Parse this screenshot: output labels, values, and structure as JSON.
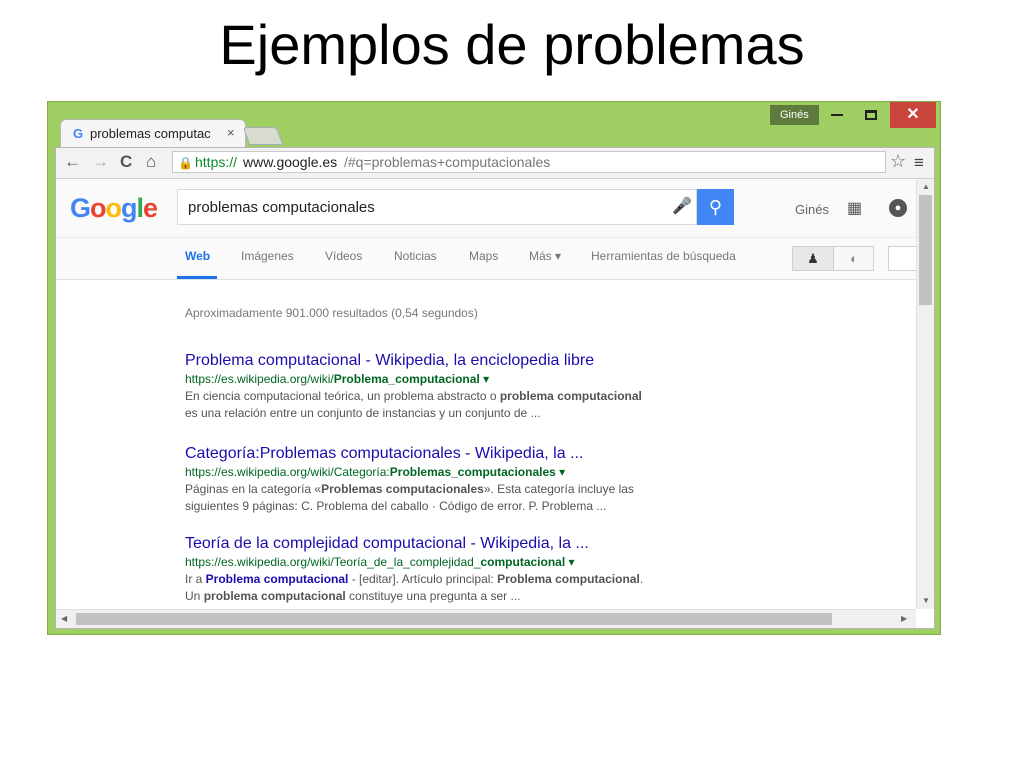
{
  "slide": {
    "title": "Ejemplos de problemas"
  },
  "window": {
    "user": "Ginés",
    "minimize_icon": "minimize-icon",
    "maximize_icon": "maximize-icon",
    "close_icon": "close-icon",
    "close_glyph": "✕"
  },
  "tab": {
    "favicon": "G",
    "title": "problemas computac",
    "close": "×"
  },
  "toolbar": {
    "back": "←",
    "forward": "→",
    "reload": "C",
    "home": "⌂",
    "url_scheme": "https://",
    "url_host": "www.google.es",
    "url_rest": "/#q=problemas+computacionales",
    "star": "☆",
    "menu": "≡"
  },
  "google": {
    "logo": [
      {
        "ch": "G",
        "color": "#4285f4"
      },
      {
        "ch": "o",
        "color": "#ea4335"
      },
      {
        "ch": "o",
        "color": "#fbbc05"
      },
      {
        "ch": "g",
        "color": "#4285f4"
      },
      {
        "ch": "l",
        "color": "#34a853"
      },
      {
        "ch": "e",
        "color": "#ea4335"
      }
    ],
    "query": "problemas computacionales",
    "user": "Ginés",
    "search_glyph": "⚲"
  },
  "nav_tabs": [
    {
      "label": "Web",
      "active": true
    },
    {
      "label": "Imágenes",
      "active": false
    },
    {
      "label": "Vídeos",
      "active": false
    },
    {
      "label": "Noticias",
      "active": false
    },
    {
      "label": "Maps",
      "active": false
    },
    {
      "label": "Más ▾",
      "active": false
    },
    {
      "label": "Herramientas de búsqueda",
      "active": false
    }
  ],
  "stats": "Aproximadamente 901.000 resultados (0,54 segundos)",
  "results": [
    {
      "title": "Problema computacional - Wikipedia, la enciclopedia libre",
      "url_plain": "https://es.wikipedia.org/wiki/",
      "url_bold": "Problema_computacional",
      "snippet1": [
        {
          "t": "En ciencia computacional teórica, un problema abstracto o "
        },
        {
          "t": "problema computacional",
          "b": true
        }
      ],
      "snippet2": [
        {
          "t": "es una relación entre un conjunto de instancias y un conjunto de ..."
        }
      ]
    },
    {
      "title": "Categoría:Problemas computacionales - Wikipedia, la ...",
      "url_plain": "https://es.wikipedia.org/wiki/Categoría:",
      "url_bold": "Problemas_computacionales",
      "snippet1": [
        {
          "t": "Páginas en la categoría «"
        },
        {
          "t": "Problemas computacionales",
          "b": true
        },
        {
          "t": "». Esta categoría incluye las"
        }
      ],
      "snippet2": [
        {
          "t": "siguientes 9 páginas: C. Problema del caballo · Código de error. P. Problema ..."
        }
      ]
    },
    {
      "title": "Teoría de la complejidad computacional - Wikipedia, la ...",
      "url_plain": "https://es.wikipedia.org/wiki/Teoría_de_la_complejidad_",
      "url_bold": "computacional",
      "snippet1": [
        {
          "t": "Ir a "
        },
        {
          "t": "Problema computacional",
          "link": true
        },
        {
          "t": " - [editar]. Artículo principal: "
        },
        {
          "t": "Problema computacional",
          "b": true
        },
        {
          "t": "."
        }
      ],
      "snippet2": [
        {
          "t": "Un "
        },
        {
          "t": "problema computacional",
          "b": true
        },
        {
          "t": " constituye una pregunta a ser ..."
        }
      ]
    }
  ],
  "colors": {
    "window_frame": "#9fce63",
    "link": "#1a0dab",
    "url": "#006621",
    "accent": "#4285f4"
  }
}
